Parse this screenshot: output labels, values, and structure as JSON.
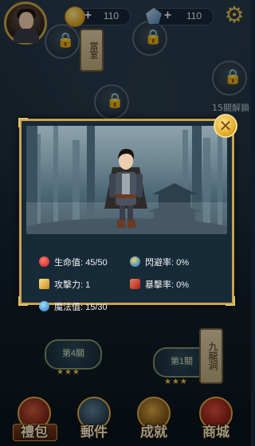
{
  "topbar": {
    "gold_value": "110",
    "gem_value": "110",
    "plus_symbol": "+"
  },
  "map": {
    "sign_top": "當室",
    "sign_right_vertical": "九龍洞",
    "unlock_hint": "15關解鎖",
    "stage_left": "第4關",
    "stage_center": "第1關",
    "stars": "★★★"
  },
  "modal": {
    "close_symbol": "✕",
    "stats": [
      {
        "key": "hp",
        "label": "生命值:",
        "value": "45/50",
        "icon": "red-orb-icon",
        "color": "#d42b2b"
      },
      {
        "key": "evasion",
        "label": "閃避率:",
        "value": "0%",
        "icon": "evasion-icon",
        "color": "#3f8fc8"
      },
      {
        "key": "attack",
        "label": "攻擊力:",
        "value": "1",
        "icon": "attack-icon",
        "color": "#e0b13a"
      },
      {
        "key": "crit",
        "label": "暴擊率:",
        "value": "0%",
        "icon": "crit-icon",
        "color": "#d0482f"
      },
      {
        "key": "mp",
        "label": "魔法值:",
        "value": "15/30",
        "icon": "mana-icon",
        "color": "#4aa0d8"
      }
    ]
  },
  "bottomnav": {
    "items": [
      {
        "label": "禮包",
        "icon": "gift-icon"
      },
      {
        "label": "郵件",
        "icon": "mail-icon"
      },
      {
        "label": "成就",
        "icon": "achievement-icon"
      },
      {
        "label": "商城",
        "icon": "shop-icon"
      }
    ]
  }
}
